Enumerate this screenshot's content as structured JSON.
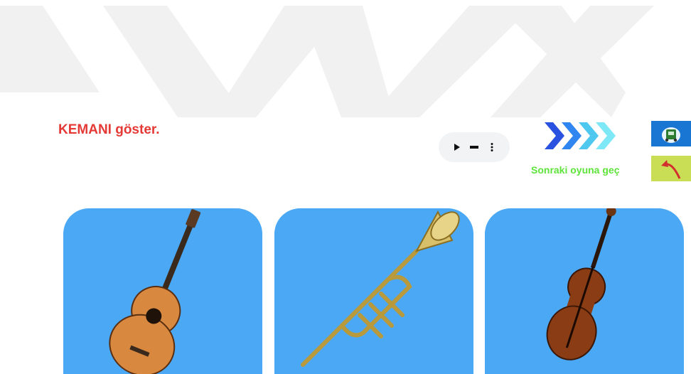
{
  "instruction": {
    "text": "KEMANI göster."
  },
  "audio_player": {
    "play_icon": "play-icon",
    "volume_icon": "volume-bar-icon",
    "menu_icon": "more-vert-icon"
  },
  "navigation": {
    "next_label": "Sonraki oyuna geç",
    "next_icon": "triple-chevron-right-icon"
  },
  "side_buttons": [
    {
      "name": "home-button",
      "icon": "home-icon",
      "color": "#1976d2"
    },
    {
      "name": "back-button",
      "icon": "curved-arrow-back-icon",
      "color": "#c9de55"
    }
  ],
  "cards": [
    {
      "name": "guitar-card",
      "instrument": "guitar"
    },
    {
      "name": "trumpet-card",
      "instrument": "trumpet"
    },
    {
      "name": "violin-card",
      "instrument": "violin"
    }
  ],
  "colors": {
    "prompt": "#e53935",
    "next_label": "#5ee33a",
    "card_bg": "#4aa8f4",
    "background_chevrons": "#f2f2f2"
  }
}
